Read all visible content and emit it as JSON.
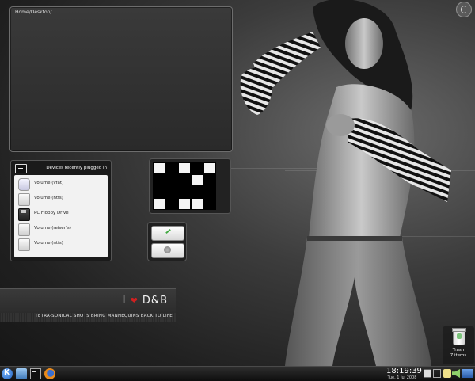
{
  "folder_view": {
    "path": "Home/Desktop/"
  },
  "device_notifier": {
    "title": "Devices recently plugged in",
    "items": [
      {
        "label": "Volume (vfat)",
        "icon": "usb-drive-icon"
      },
      {
        "label": "Volume (ntfs)",
        "icon": "hard-disk-icon"
      },
      {
        "label": "PC Floppy Drive",
        "icon": "floppy-icon"
      },
      {
        "label": "Volume (reiserfs)",
        "icon": "hard-disk-icon"
      },
      {
        "label": "Volume (ntfs)",
        "icon": "hard-disk-icon"
      }
    ]
  },
  "puzzle": {
    "rows": [
      [
        "w",
        "b",
        "w",
        "b",
        "w"
      ],
      [
        "b",
        "b",
        "b",
        "w",
        "b"
      ],
      [
        "b",
        "b",
        "b",
        "b",
        "b"
      ],
      [
        "w",
        "b",
        "w",
        "w",
        "b"
      ]
    ]
  },
  "banner": {
    "love_prefix": "I",
    "love_suffix": "D&B",
    "tagline": "TETRA-SONICAL SHOTS BRING MANNEQUINS BACK TO LIFE"
  },
  "trash": {
    "label": "Trash",
    "count": "7 items"
  },
  "taskbar": {
    "time": "18:19:39",
    "date": "Tue, 1 Jul 2008"
  },
  "colors": {
    "heart": "#d02020",
    "accent_blue": "#1e5db8"
  }
}
